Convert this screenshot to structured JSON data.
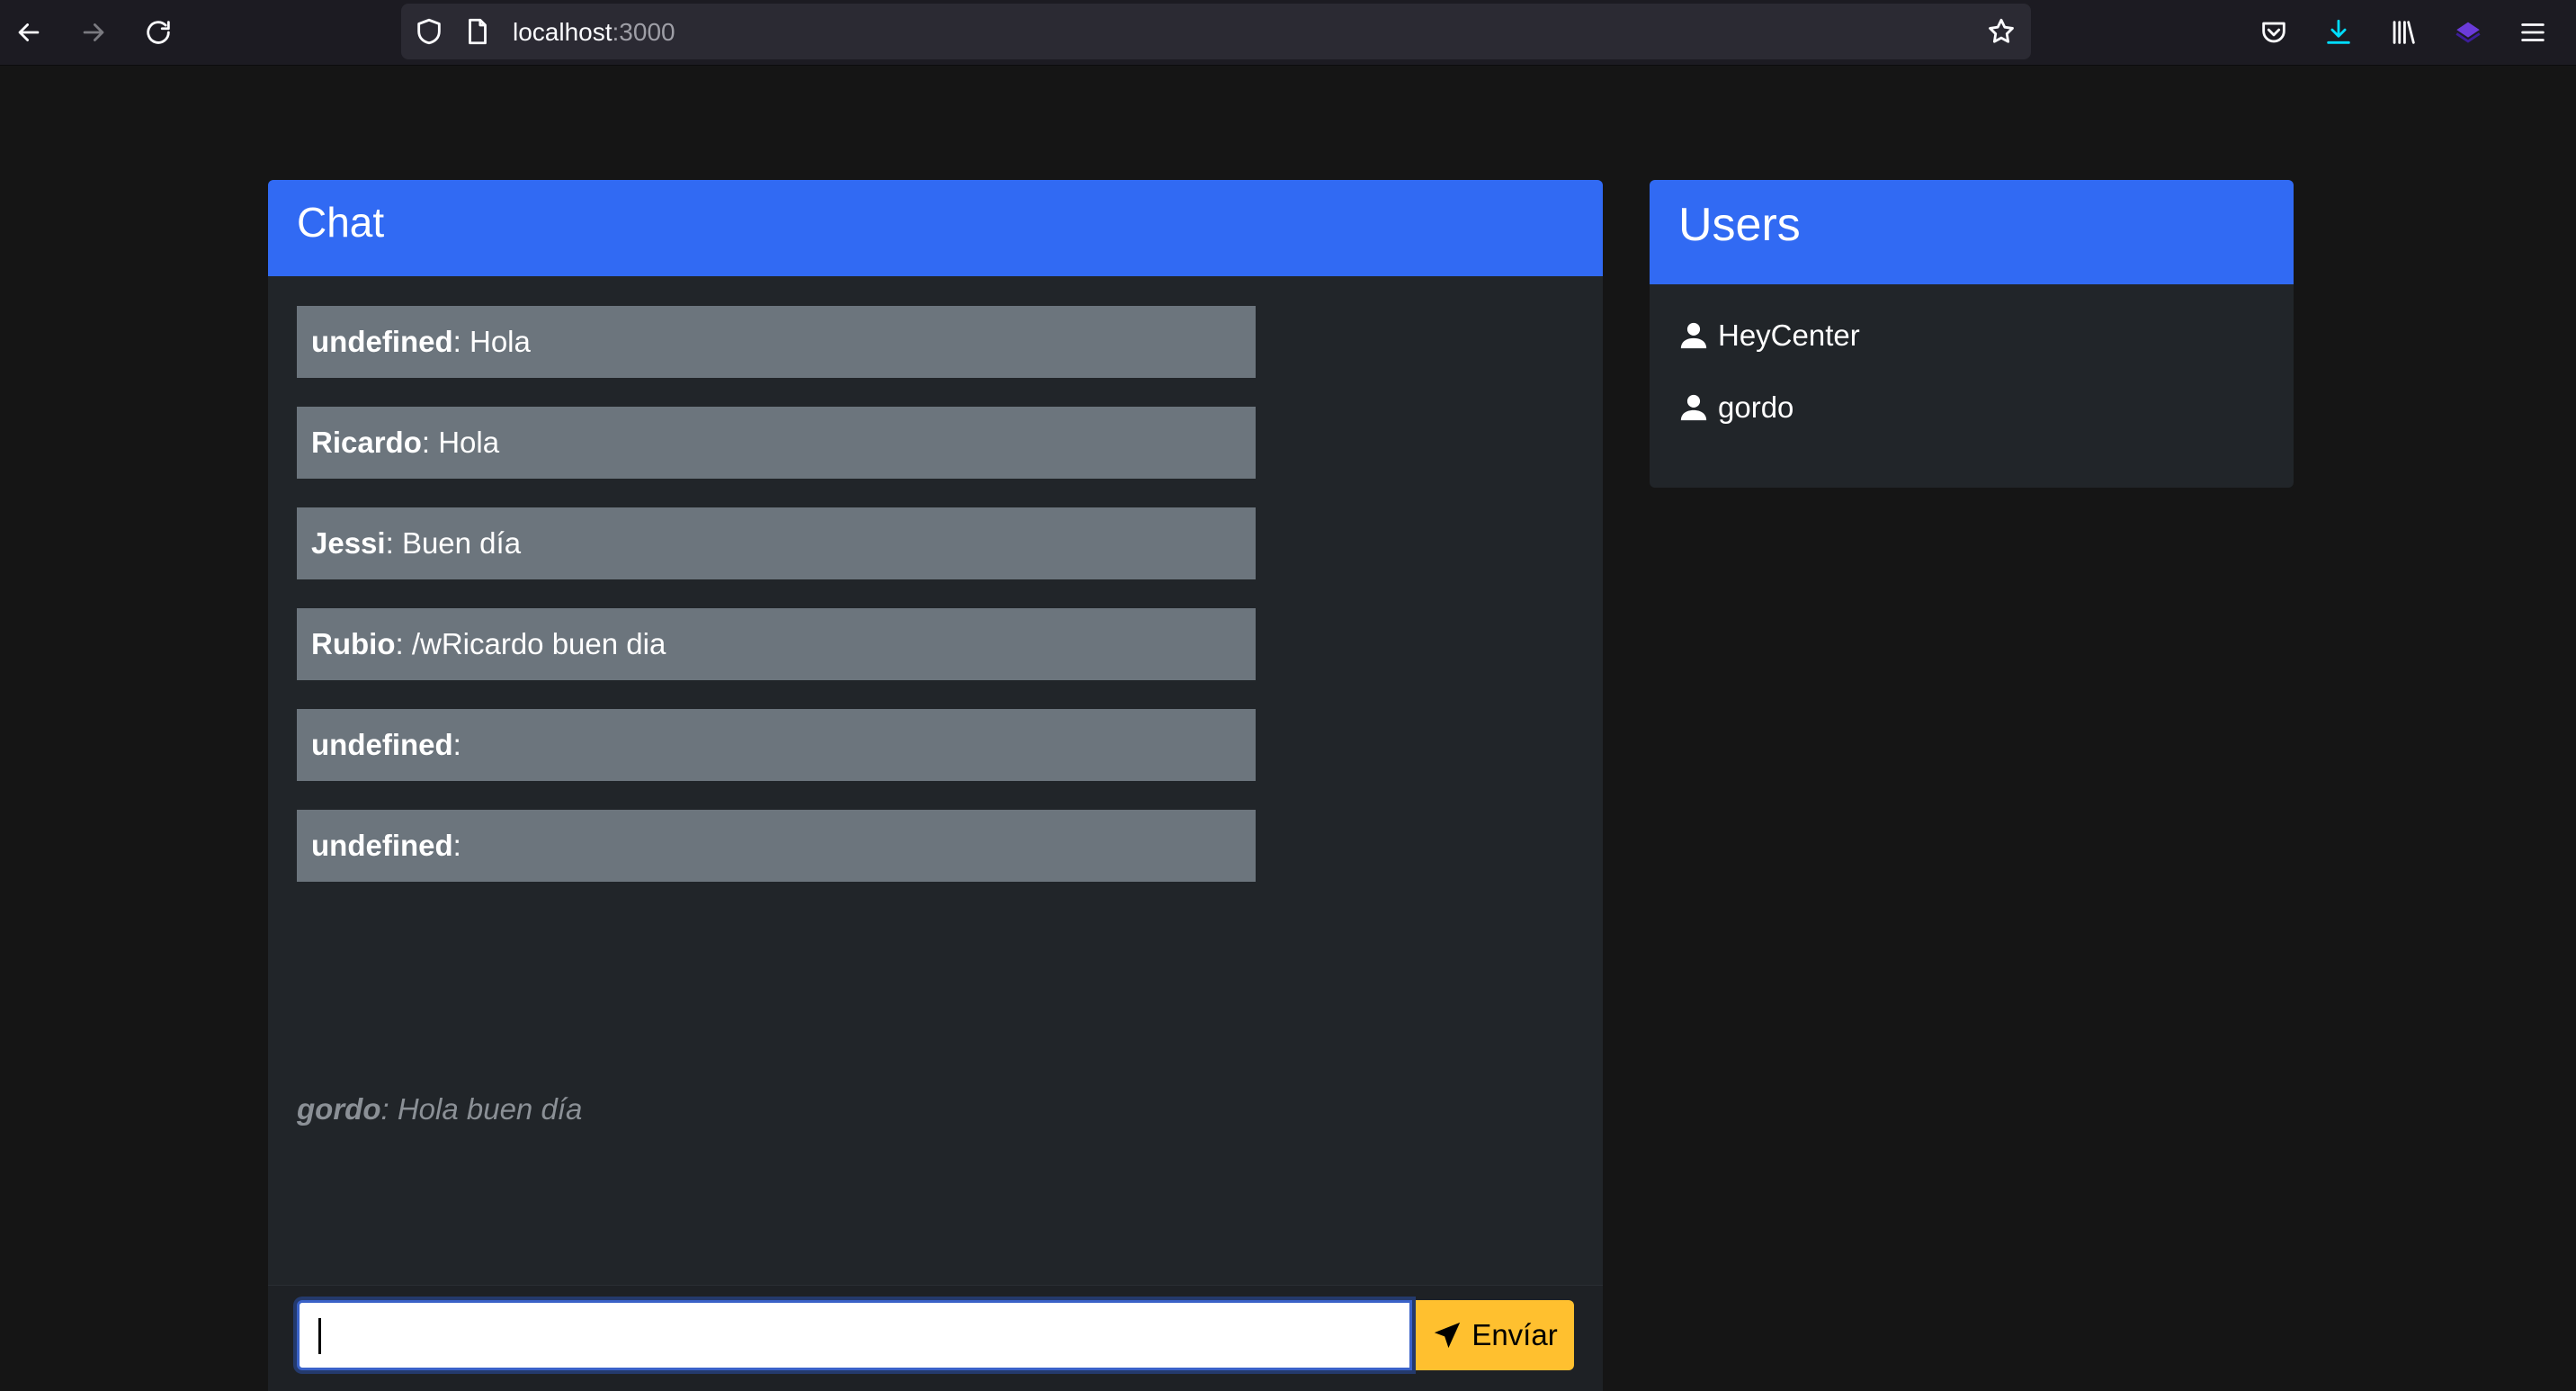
{
  "browser": {
    "url_host": "localhost",
    "url_port": ":3000"
  },
  "chat": {
    "title": "Chat",
    "messages": [
      {
        "user": "undefined",
        "sep": ": ",
        "text": "Hola"
      },
      {
        "user": "Ricardo",
        "sep": ": ",
        "text": "Hola"
      },
      {
        "user": "Jessi",
        "sep": ": ",
        "text": "Buen día"
      },
      {
        "user": "Rubio",
        "sep": ": ",
        "text": "/wRicardo buen dia"
      },
      {
        "user": "undefined",
        "sep": ":",
        "text": ""
      },
      {
        "user": "undefined",
        "sep": ":",
        "text": ""
      }
    ],
    "typing": {
      "user": "gordo",
      "text": ": Hola buen día"
    },
    "input": {
      "value": "",
      "placeholder": ""
    },
    "send_label": "Envíar"
  },
  "users": {
    "title": "Users",
    "items": [
      "HeyCenter",
      "gordo"
    ]
  }
}
